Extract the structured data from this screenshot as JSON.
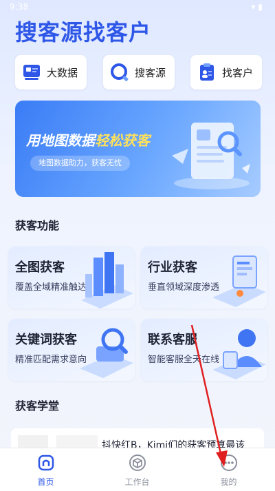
{
  "status_bar": {
    "time": "9:38"
  },
  "app": {
    "title": "搜客源找客户"
  },
  "quick_actions": [
    {
      "label": "大数据",
      "icon": "big-data-icon"
    },
    {
      "label": "搜客源",
      "icon": "search-customer-icon"
    },
    {
      "label": "找客户",
      "icon": "find-customer-icon"
    }
  ],
  "banner": {
    "headline_main": "用地图数据",
    "headline_highlight": "轻松获客",
    "tagline": "地图数据助力，获客无忧"
  },
  "sections": {
    "features_title": "获客功能",
    "academy_title": "获客学堂"
  },
  "features": [
    {
      "title": "全图获客",
      "subtitle": "覆盖全域精准触达"
    },
    {
      "title": "行业获客",
      "subtitle": "垂直领域深度渗透"
    },
    {
      "title": "关键词获客",
      "subtitle": "精准匹配需求意向"
    },
    {
      "title": "联系客服",
      "subtitle": "智能客服全天在线"
    }
  ],
  "article": {
    "title": "抖快红B，Kimi们的获客预算最该"
  },
  "tabs": [
    {
      "label": "首页",
      "active": true
    },
    {
      "label": "工作台",
      "active": false
    },
    {
      "label": "我的",
      "active": false
    }
  ],
  "colors": {
    "accent": "#2e57e8",
    "highlight": "#ffe25a",
    "annotation_arrow": "#e02020"
  }
}
